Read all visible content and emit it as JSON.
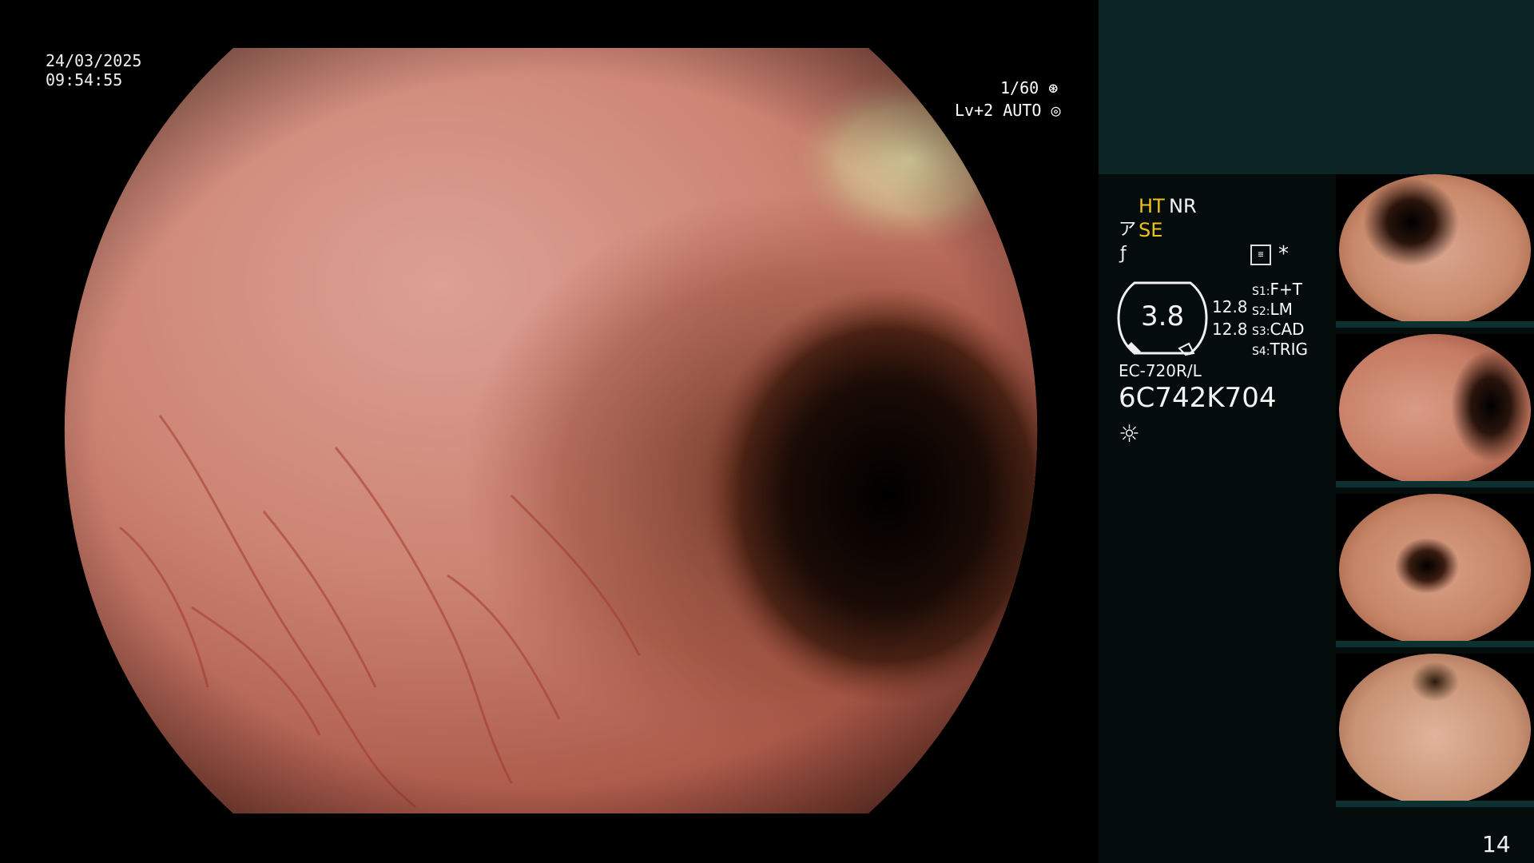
{
  "overlay": {
    "date": "24/03/2025",
    "time": "09:54:55",
    "shutter": "1/60",
    "level": "Lv+2",
    "exposure": "AUTO"
  },
  "panel": {
    "modes_row1": [
      "HT",
      "NR"
    ],
    "mode_se": "SE",
    "gauge_value": "3.8",
    "gauge_right_top": "12.8",
    "gauge_right_bottom": "12.8",
    "switches": [
      {
        "key": "S1",
        "value": "F+T"
      },
      {
        "key": "S2",
        "value": "LM"
      },
      {
        "key": "S3",
        "value": "CAD"
      },
      {
        "key": "S4",
        "value": "TRIG"
      }
    ],
    "scope_model": "EC-720R/L",
    "serial": "6C742K704",
    "asterisk": "*"
  },
  "thumbnails": [
    {
      "label": "captured image 1",
      "color": "#c98a6b"
    },
    {
      "label": "captured image 2",
      "color": "#c57c63"
    },
    {
      "label": "captured image 3",
      "color": "#c58465"
    },
    {
      "label": "captured image 4",
      "color": "#c89274"
    }
  ],
  "page_number": "14",
  "colors": {
    "accent_yellow": "#f2c01e",
    "panel_top": "#0c2426",
    "panel_bottom": "#040c0c"
  }
}
